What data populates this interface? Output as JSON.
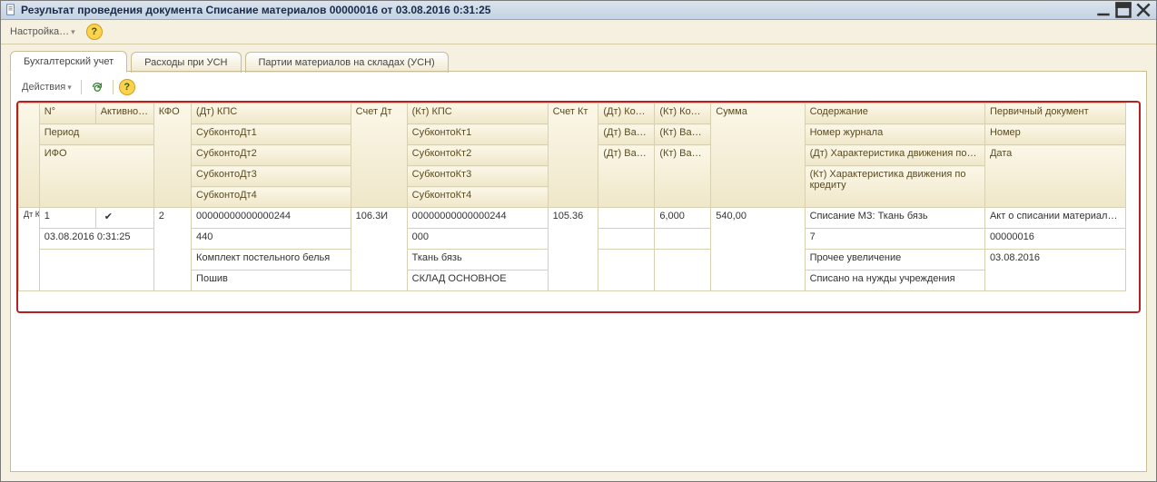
{
  "title": "Результат проведения документа Списание материалов 00000016 от 03.08.2016 0:31:25",
  "menu": {
    "settings": "Настройка…"
  },
  "tabs": {
    "t1": "Бухгалтерский учет",
    "t2": "Расходы при УСН",
    "t3": "Партии материалов на складах (УСН)"
  },
  "toolbar": {
    "actions": "Действия"
  },
  "icons": {
    "dtkt": "Дт Кт"
  },
  "headers": {
    "row1": {
      "num": "N°",
      "active": "Активно…",
      "kfo": "КФО",
      "dtkps": "(Дт) КПС",
      "acct_dt": "Счет Дт",
      "ktkps": "(Кт) КПС",
      "acct_kt": "Счет Кт",
      "dt_qty": "(Дт) Коли…",
      "kt_qty": "(Кт) Коли…",
      "sum": "Сумма",
      "content": "Содержание",
      "primdoc": "Первичный документ"
    },
    "row2": {
      "period": "Период",
      "sub_dt1": "СубконтоДт1",
      "sub_kt1": "СубконтоКт1",
      "dt_val": "(Дт) Валю…",
      "kt_val": "(Кт) Валю…",
      "journal": "Номер журнала",
      "number": "Номер"
    },
    "row3": {
      "ifo": "ИФО",
      "sub_dt2": "СубконтоДт2",
      "sub_kt2": "СубконтоКт2",
      "dt_valsum": "(Дт) Вал. сумма",
      "kt_valsum": "(Кт) Вал. сумма",
      "dt_char": "(Дт) Характеристика движения по…",
      "date": "Дата"
    },
    "row4": {
      "sub_dt3": "СубконтоДт3",
      "sub_kt3": "СубконтоКт3",
      "kt_char": "(Кт) Характеристика движения по кредиту"
    },
    "row5": {
      "sub_dt4": "СубконтоДт4",
      "sub_kt4": "СубконтоКт4"
    }
  },
  "data": {
    "row1": {
      "num": "1",
      "check": "✔",
      "kfo": "2",
      "dtkps": "00000000000000244",
      "acct_dt": "106.3И",
      "ktkps": "00000000000000244",
      "acct_kt": "105.36",
      "kt_qty": "6,000",
      "sum": "540,00",
      "content": "Списание МЗ: Ткань бязь",
      "primdoc": "Акт о списании материало…"
    },
    "row2": {
      "period": "03.08.2016 0:31:25",
      "sub_dt1": "440",
      "sub_kt1": "000",
      "journal": "7",
      "number": "00000016"
    },
    "row3": {
      "sub_dt2": "Комплект постельного белья",
      "sub_kt2": "Ткань бязь",
      "dt_char": "Прочее увеличение",
      "date": "03.08.2016"
    },
    "row4": {
      "sub_dt3": "Пошив",
      "sub_kt3": "СКЛАД ОСНОВНОЕ",
      "kt_char": "Списано на нужды учреждения"
    }
  }
}
